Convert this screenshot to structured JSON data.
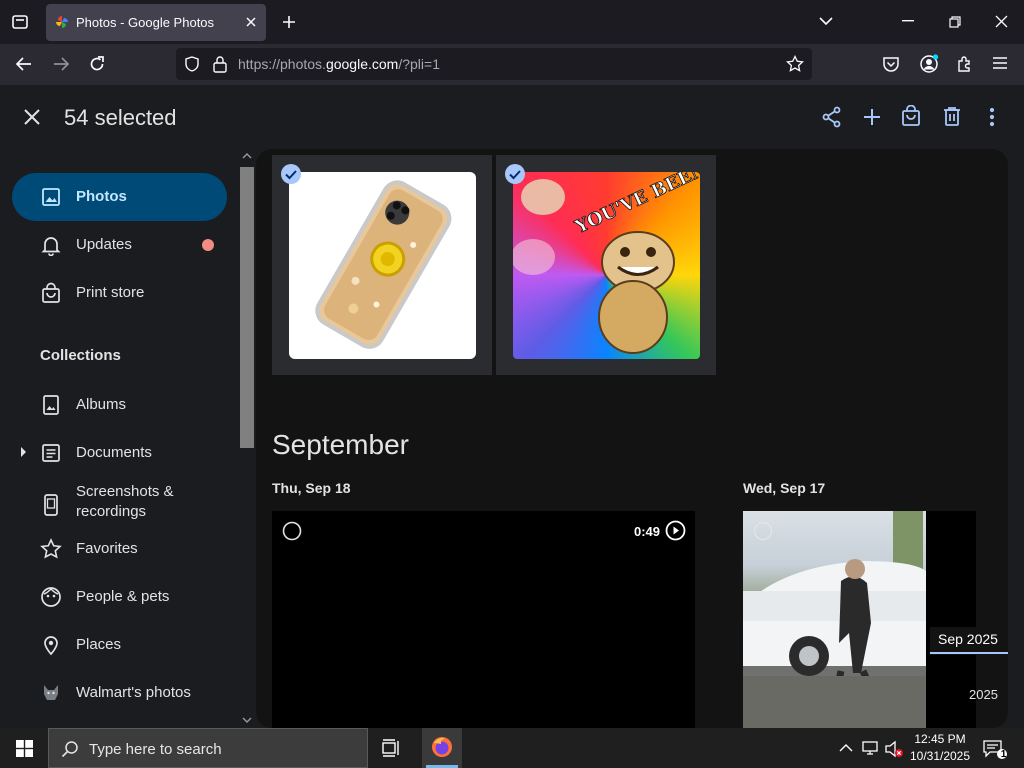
{
  "browser": {
    "tab_title": "Photos - Google Photos",
    "url_prefix": "https://photos.",
    "url_domain": "google.com",
    "url_suffix": "/?pli=1"
  },
  "app": {
    "selected_count": "54 selected"
  },
  "sidebar": {
    "items": [
      {
        "label": "Photos"
      },
      {
        "label": "Updates"
      },
      {
        "label": "Print store"
      }
    ],
    "collections_heading": "Collections",
    "collections": [
      {
        "label": "Albums"
      },
      {
        "label": "Documents"
      },
      {
        "label": "Screenshots &"
      },
      {
        "label": "recordings"
      },
      {
        "label": "Favorites"
      },
      {
        "label": "People & pets"
      },
      {
        "label": "Places"
      },
      {
        "label": "Walmart's photos"
      }
    ]
  },
  "grid": {
    "meme_text": "YOU'VE BEEN TROLLED!!!",
    "month_heading": "September",
    "day1": "Thu, Sep 18",
    "day2": "Wed, Sep 17",
    "video_duration": "0:49",
    "scrub_date": "Sep 2025",
    "scrub_year": "2025"
  },
  "taskbar": {
    "search_placeholder": "Type here to search",
    "time": "12:45 PM",
    "date": "10/31/2025",
    "notif_count": "1"
  },
  "colors": {
    "accent": "#004a77",
    "accent_text": "#c2e7ff",
    "select_check": "#a8c7fa",
    "update_dot": "#f28b82",
    "toolbar_icon": "#a8c7fa"
  }
}
